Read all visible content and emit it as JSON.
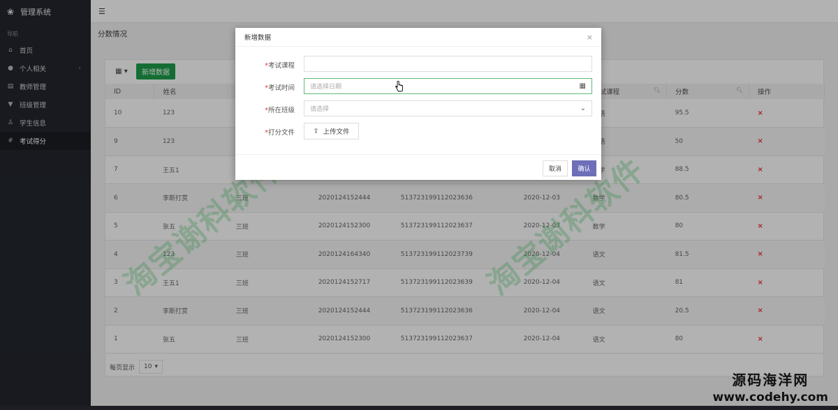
{
  "sidebar": {
    "title": "管理系统",
    "nav_caption": "导航",
    "items": [
      {
        "label": "首页",
        "icon": "home-icon"
      },
      {
        "label": "个人相关",
        "icon": "user-icon"
      },
      {
        "label": "教师管理",
        "icon": "list-icon"
      },
      {
        "label": "班级管理",
        "icon": "filter-icon"
      },
      {
        "label": "学生信息",
        "icon": "people-icon"
      },
      {
        "label": "考试得分",
        "icon": "hash-icon"
      }
    ]
  },
  "page": {
    "breadcrumb": "分数情况",
    "add_button": "新增数据"
  },
  "table": {
    "headers": [
      "ID",
      "姓名",
      "",
      "",
      "",
      "",
      "考试课程",
      "分数",
      "操作"
    ],
    "rows": [
      [
        "10",
        "123",
        "",
        "",
        "",
        "",
        "英语",
        "95.5"
      ],
      [
        "9",
        "123",
        "",
        "",
        "",
        "",
        "英语",
        "50"
      ],
      [
        "7",
        "王五1",
        "",
        "",
        "",
        "",
        "数学",
        "88.5"
      ],
      [
        "6",
        "李斯打赏",
        "三班",
        "2020124152444",
        "513723199112023636",
        "2020-12-03",
        "数学",
        "80.5"
      ],
      [
        "5",
        "张五",
        "三班",
        "2020124152300",
        "513723199112023637",
        "2020-12-03",
        "数学",
        "80"
      ],
      [
        "4",
        "123",
        "三班",
        "2020124164340",
        "513723199112023739",
        "2020-12-04",
        "语文",
        "81.5"
      ],
      [
        "3",
        "王五1",
        "三班",
        "2020124152717",
        "513723199112023639",
        "2020-12-04",
        "语文",
        "81"
      ],
      [
        "2",
        "李斯打赏",
        "三班",
        "2020124152444",
        "513723199112023636",
        "2020-12-04",
        "语文",
        "20.5"
      ],
      [
        "1",
        "张五",
        "三班",
        "2020124152300",
        "513723199112023637",
        "2020-12-04",
        "语文",
        "80"
      ]
    ],
    "delete_glyph": "×"
  },
  "pager": {
    "per_page_label": "每页显示",
    "per_page_value": "10"
  },
  "dialog": {
    "title": "新增数据",
    "close": "×",
    "fields": [
      {
        "label": "考试课程",
        "required": true,
        "value": "",
        "placeholder": ""
      },
      {
        "label": "考试时间",
        "required": true,
        "value": "",
        "placeholder": "请选择日期"
      },
      {
        "label": "所在班级",
        "required": true,
        "value": "",
        "placeholder": "请选择"
      },
      {
        "label": "打分文件",
        "required": true,
        "button": "上传文件"
      }
    ],
    "required_mark": "*",
    "cancel": "取消",
    "ok": "确认"
  },
  "watermarks": {
    "text": "淘宝谢科软件"
  },
  "corner_brand": {
    "line1": "源码海洋网",
    "line2": "www.codehy.com"
  },
  "colors": {
    "sidebar_bg": "#23262e",
    "add_button": "#1e9e4a",
    "ok_button": "#6e6fb8",
    "delete": "#e33333",
    "focus_border": "#5fb878"
  }
}
